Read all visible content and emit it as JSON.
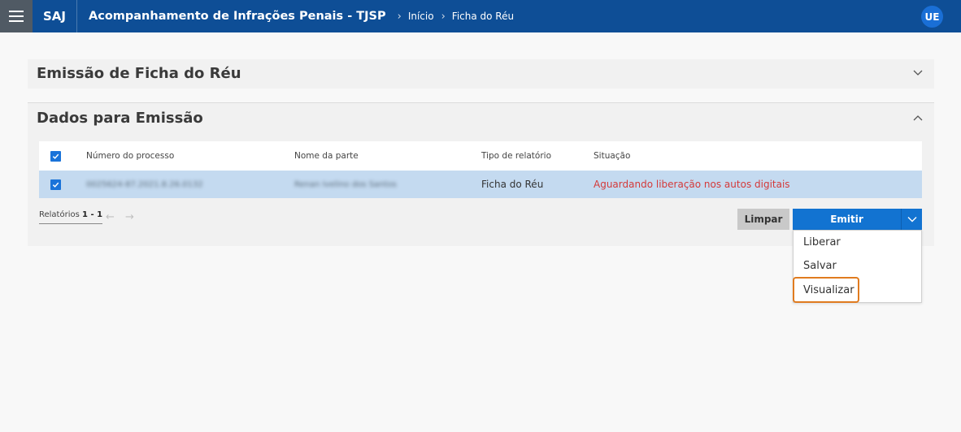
{
  "header": {
    "brand": "SAJ",
    "title": "Acompanhamento de Infrações Penais - TJSP",
    "breadcrumbs": [
      "Início",
      "Ficha do Réu"
    ],
    "user_initials": "UE"
  },
  "panels": {
    "emissao_title": "Emissão de Ficha do Réu",
    "dados_title": "Dados para Emissão"
  },
  "table": {
    "columns": [
      "Número do processo",
      "Nome da parte",
      "Tipo de relatório",
      "Situação"
    ],
    "rows": [
      {
        "numero": "0025624-87.2021.8.26.0132",
        "nome": "Renan Ivelino dos Santos",
        "tipo": "Ficha do Réu",
        "situacao": "Aguardando liberação nos autos digitais"
      }
    ]
  },
  "pagination": {
    "label": "Relatórios",
    "range": "1 - 1"
  },
  "actions": {
    "limpar": "Limpar",
    "emitir": "Emitir",
    "menu": [
      "Liberar",
      "Salvar",
      "Visualizar"
    ]
  },
  "colors": {
    "header_bg": "#0e4e96",
    "primary": "#1273d1",
    "status_red": "#d43a3a",
    "highlight": "#e07b1f"
  }
}
